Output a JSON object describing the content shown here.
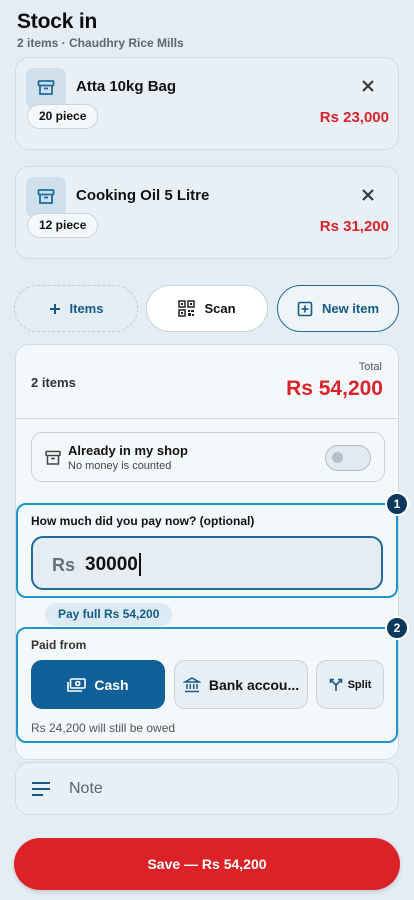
{
  "header": {
    "title": "Stock in",
    "subtitle": "2 items · Chaudhry Rice Mills"
  },
  "items": [
    {
      "name": "Atta 10kg Bag",
      "qty": "20 piece",
      "price": "Rs 23,000"
    },
    {
      "name": "Cooking Oil 5 Litre",
      "qty": "12 piece",
      "price": "Rs 31,200"
    }
  ],
  "actions": {
    "items_label": "Items",
    "scan_label": "Scan",
    "new_item_label": "New item"
  },
  "summary": {
    "count": "2 items",
    "total_label": "Total",
    "total": "Rs 54,200"
  },
  "in_shop": {
    "title": "Already in my shop",
    "subtitle": "No money is counted",
    "enabled": false
  },
  "payment": {
    "step1": "1",
    "label": "How much did you pay now? (optional)",
    "currency": "Rs",
    "value": "30000",
    "pay_full_label": "Pay full Rs 54,200",
    "step2": "2",
    "paid_from_label": "Paid from",
    "methods": {
      "cash": "Cash",
      "bank": "Bank accou...",
      "split": "Split"
    },
    "selected": "cash",
    "owed_text": "Rs 24,200 will still be owed"
  },
  "note": {
    "placeholder": "Note"
  },
  "save": {
    "label": "Save — Rs 54,200"
  },
  "colors": {
    "accent": "#11609a",
    "price": "#d8242b",
    "save": "#dd2227",
    "highlight": "#1d96cc"
  }
}
